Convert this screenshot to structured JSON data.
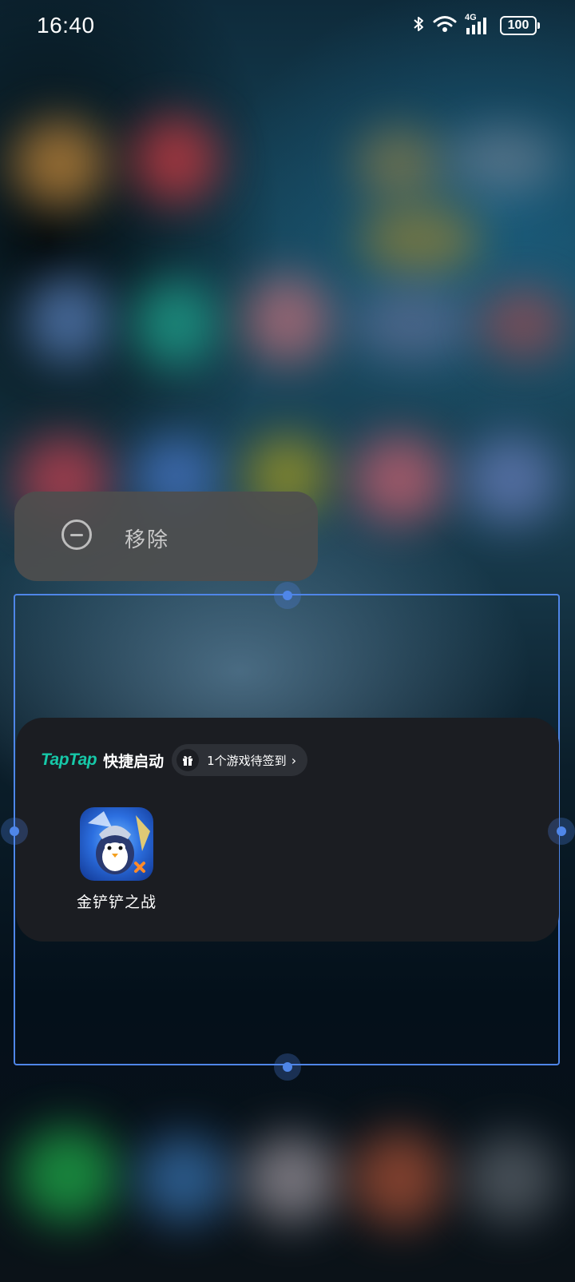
{
  "status_bar": {
    "time": "16:40",
    "network": "4G",
    "battery": "100"
  },
  "context_menu": {
    "remove_label": "移除"
  },
  "widget": {
    "brand": "TapTap",
    "title": "快捷启动",
    "checkin_chip": "1个游戏待签到",
    "games": [
      {
        "name": "金铲铲之战",
        "icon": "penguin-game-icon"
      }
    ]
  },
  "colors": {
    "frame": "#4f86e8",
    "taptap_brand": "#16c8a8",
    "card_bg": "#1b1d22"
  }
}
